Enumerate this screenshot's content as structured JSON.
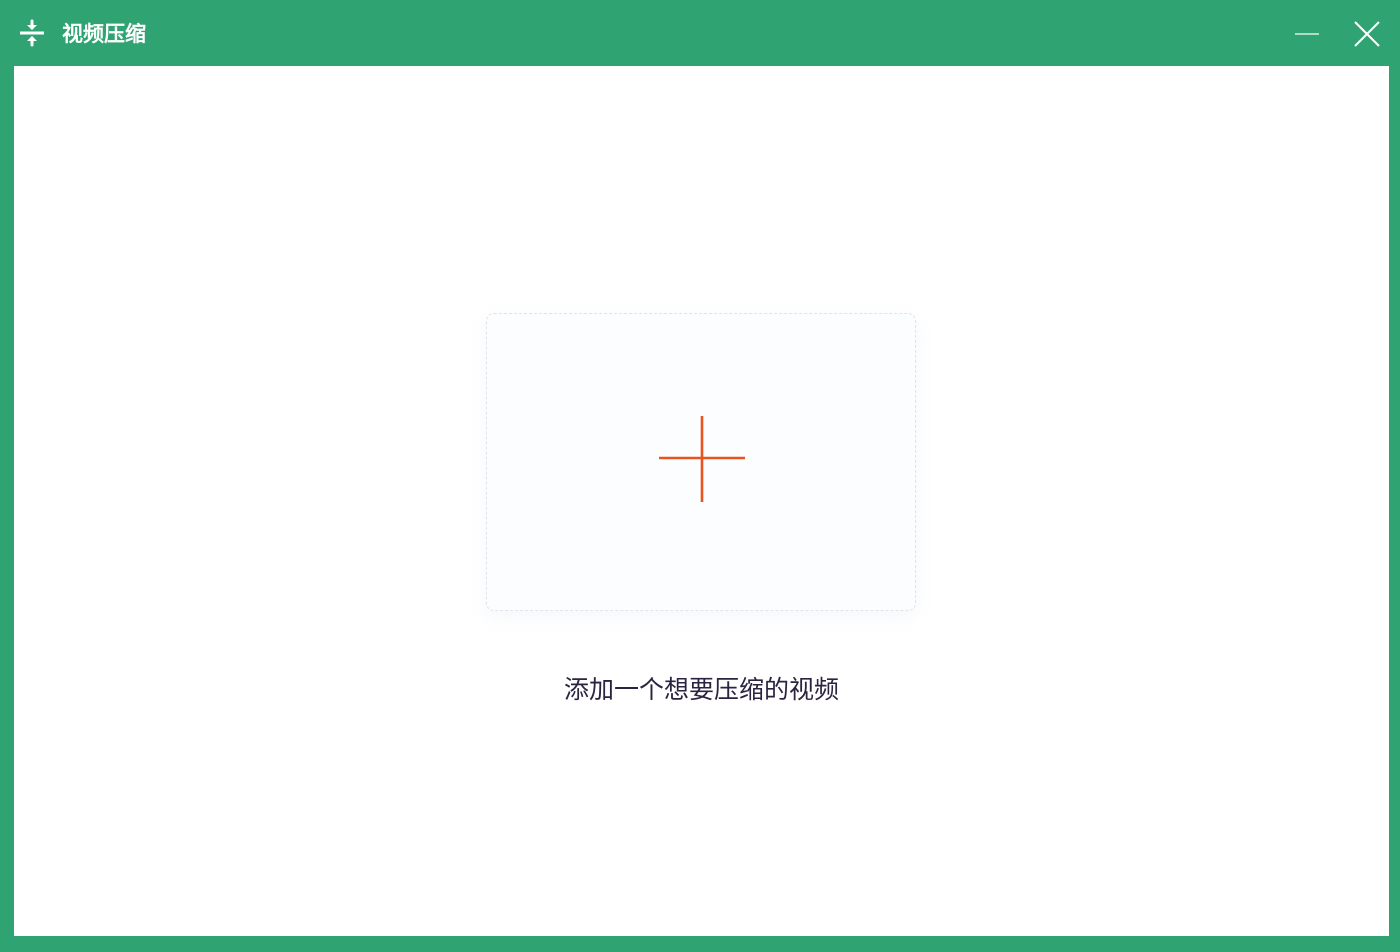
{
  "window": {
    "title": "视频压缩",
    "app_icon": "compress-arrows-icon",
    "minimize_icon": "minimize-icon",
    "close_icon": "close-icon"
  },
  "colors": {
    "frame": "#2fa371",
    "content_bg": "#ffffff",
    "plus_accent": "#e8531e",
    "label_text": "#2b2340",
    "dropzone_border": "#dfe3ea"
  },
  "dropzone": {
    "icon": "plus-icon",
    "label": "添加一个想要压缩的视频"
  }
}
